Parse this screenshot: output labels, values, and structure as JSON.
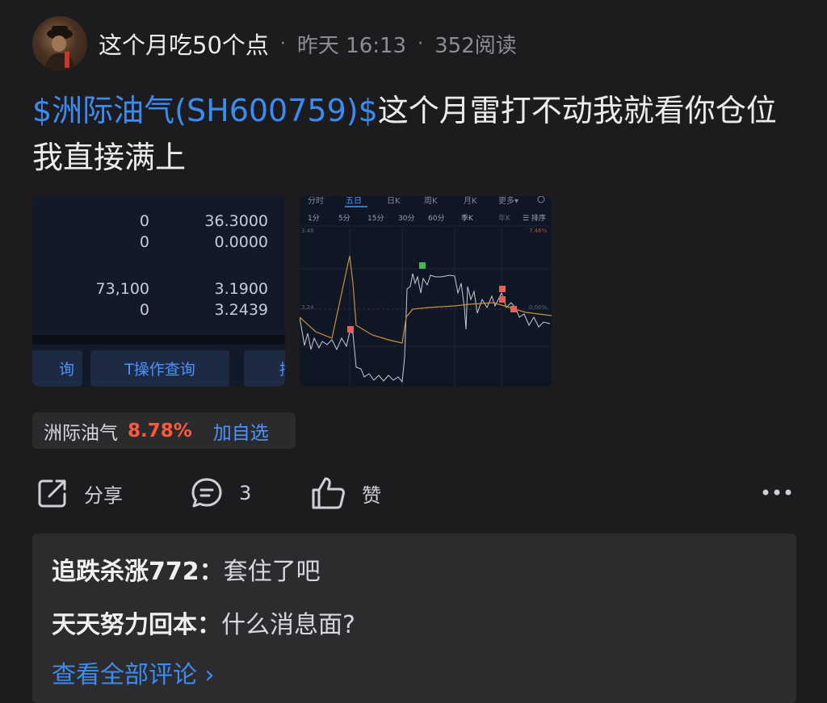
{
  "post": {
    "author": "这个月吃50个点",
    "time": "昨天 16:13",
    "views": "352阅读",
    "stock_link": "$洲际油气(SH600759)$",
    "text": "这个月雷打不动我就看你仓位我直接满上"
  },
  "image1": {
    "rows": [
      {
        "left": "0",
        "right": "36.3000"
      },
      {
        "left": "0",
        "right": "0.0000"
      },
      {
        "left": "73,100",
        "right": "3.1900"
      },
      {
        "left": "0",
        "right": "3.2439"
      }
    ],
    "buttons": [
      "询",
      "T操作查询",
      "持"
    ]
  },
  "image2": {
    "period_tabs": [
      "分时",
      "五日",
      "日K",
      "周K",
      "月K",
      "更多▾"
    ],
    "interval_tabs": [
      "1分",
      "5分",
      "15分",
      "30分",
      "60分",
      "季K",
      "年K",
      "☰ 排序"
    ],
    "top_price": "3.48",
    "top_pct": "7.46%",
    "mid_price": "3.24",
    "mid_pct": "0.00%"
  },
  "stock_tag": {
    "name": "洲际油气",
    "change": "8.78%",
    "add_label": "加自选"
  },
  "actions": {
    "share": "分享",
    "comment_count": "3",
    "like": "赞"
  },
  "comments": [
    {
      "author": "追跌杀涨772",
      "sep": "：",
      "text": "套住了吧"
    },
    {
      "author": "天天努力回本",
      "sep": "：",
      "text": "什么消息面?"
    }
  ],
  "view_all": "查看全部评论 ›",
  "colors": {
    "link": "#3c8bf0",
    "gain": "#ff5a3c",
    "background": "#1c1c1e"
  }
}
